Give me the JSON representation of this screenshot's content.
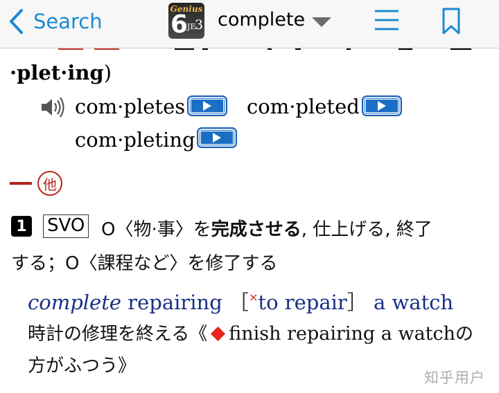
{
  "nav": {
    "back_label": "Search",
    "app_logo": {
      "genius": "Genius",
      "edition": "6",
      "je": "JE",
      "je_num": "3"
    },
    "current_word": "complete",
    "icons": [
      "chevron-left-icon",
      "caret-down-icon",
      "hamburger-menu-icon",
      "bookmark-icon"
    ],
    "accent_color": "#1b8ad3"
  },
  "entry": {
    "syllab_line": "·plet·ing",
    "syllab_close": ")",
    "forms": [
      {
        "text": "com·pletes"
      },
      {
        "text": "com·pleted"
      },
      {
        "text": "com·pleting"
      }
    ],
    "pos_badge": "他",
    "pos_color": "#b5241a",
    "sense": {
      "number": "1",
      "pattern": "SVO",
      "line1_a": "O〈物·事〉を",
      "line1_bold": "完成させる",
      "line1_b": ", 仕上げる, 終了",
      "line2": "する；O〈課程など〉を修了する"
    },
    "example": {
      "word_italic": "complete",
      "after_word": " repairing ",
      "bracket_open": "［",
      "cross_mark": "×",
      "alt": "to repair",
      "bracket_close": "］",
      "tail": " a watch",
      "translation_a": "時計の修理を終える《",
      "translation_en": "finish repairing a watch",
      "translation_b": "の",
      "translation_line2": "方がふつう》"
    }
  },
  "watermark": "知乎用户"
}
